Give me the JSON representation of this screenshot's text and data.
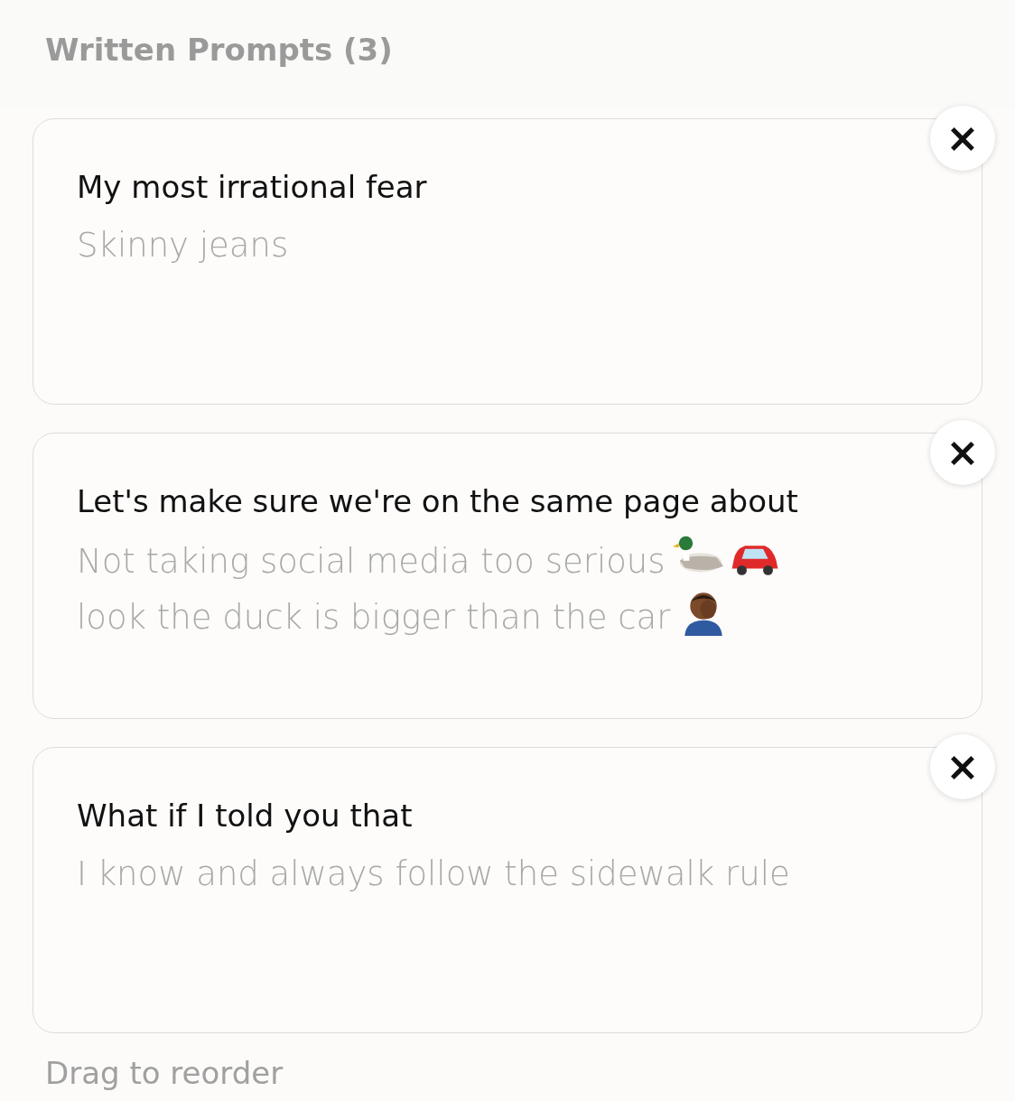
{
  "section": {
    "title": "Written Prompts (3)"
  },
  "prompts": [
    {
      "question": "My most irrational fear",
      "answer": [
        {
          "kind": "text",
          "text": "Skinny jeans"
        }
      ]
    },
    {
      "question": "Let's make sure we're on the same page about",
      "answer": [
        {
          "kind": "text",
          "text": "Not taking social media too serious"
        },
        {
          "kind": "duck"
        },
        {
          "kind": "car"
        },
        {
          "kind": "text",
          "text": "look the duck is bigger than the car"
        },
        {
          "kind": "facepalm"
        }
      ]
    },
    {
      "question": "What if I told you that",
      "answer": [
        {
          "kind": "text",
          "text": "I know and always follow the sidewalk rule"
        }
      ]
    }
  ],
  "close_label": "×",
  "footer": "Drag to reorder"
}
